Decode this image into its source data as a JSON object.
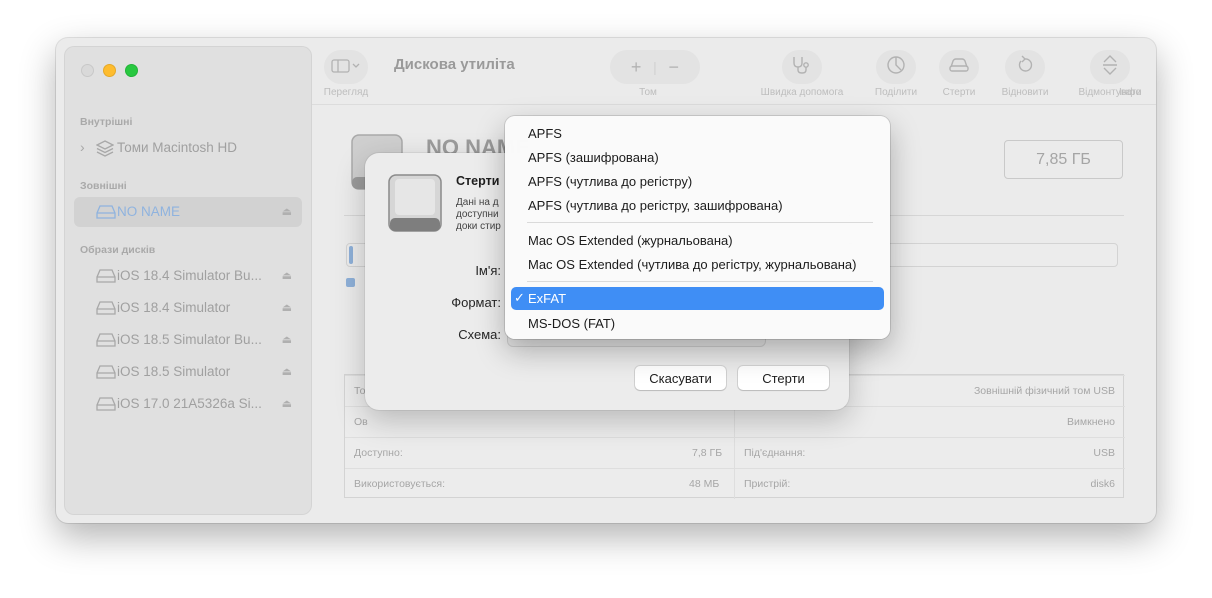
{
  "window": {
    "title": "Дискова утиліта"
  },
  "sidebar": {
    "sections": [
      {
        "label": "Внутрішні"
      },
      {
        "label": "Зовнішні"
      },
      {
        "label": "Образи дисків"
      }
    ],
    "internal": [
      {
        "label": "Томи Macintosh HD",
        "icon": "layers-icon"
      }
    ],
    "external": [
      {
        "label": "NO NAME",
        "icon": "external-drive-icon",
        "eject": "⏏"
      }
    ],
    "images": [
      {
        "label": "iOS 18.4 Simulator Bu...",
        "eject": "⏏"
      },
      {
        "label": "iOS 18.4 Simulator",
        "eject": "⏏"
      },
      {
        "label": "iOS 18.5 Simulator Bu...",
        "eject": "⏏"
      },
      {
        "label": "iOS 18.5 Simulator",
        "eject": "⏏"
      },
      {
        "label": "iOS 17.0 21A5326a Si...",
        "eject": "⏏"
      }
    ]
  },
  "toolbar": {
    "view_label": "Перегляд",
    "volume_label": "Том",
    "first_aid_label": "Швидка допомога",
    "partition_label": "Поділити",
    "erase_label": "Стерти",
    "restore_label": "Відновити",
    "unmount_label": "Відмонтувати",
    "info_label": "Інфо"
  },
  "main": {
    "volume_name": "NO NAME",
    "size": "7,85 ГБ",
    "info": {
      "rows": [
        {
          "left_label": "То",
          "left_value": "",
          "right_label": "",
          "right_value": "Зовнішній фізичний том USB"
        },
        {
          "left_label": "Ов",
          "left_value": "",
          "right_label": "",
          "right_value": "Вимкнено"
        },
        {
          "left_label": "Доступно:",
          "left_value": "7,8 ГБ",
          "right_label": "Під'єднання:",
          "right_value": "USB"
        },
        {
          "left_label": "Використовується:",
          "left_value": "48 МБ",
          "right_label": "Пристрій:",
          "right_value": "disk6"
        }
      ]
    }
  },
  "sheet": {
    "title": "Стерти",
    "desc": [
      "Дані на д",
      "доступни",
      "доки стир"
    ],
    "name_label": "Ім'я:",
    "format_label": "Формат:",
    "scheme_label": "Схема:",
    "cancel_label": "Скасувати",
    "erase_label": "Стерти"
  },
  "format_menu": {
    "groups": [
      [
        "APFS",
        "APFS (зашифрована)",
        "APFS (чутлива до регістру)",
        "APFS (чутлива до регістру, зашифрована)"
      ],
      [
        "Mac OS Extended (журнальована)",
        "Mac OS Extended (чутлива до регістру, журнальована)"
      ],
      [
        "ExFAT",
        "MS-DOS (FAT)"
      ]
    ],
    "selected": "ExFAT",
    "checkmark": "✓",
    "highlight_color": "#3f8ef5"
  }
}
